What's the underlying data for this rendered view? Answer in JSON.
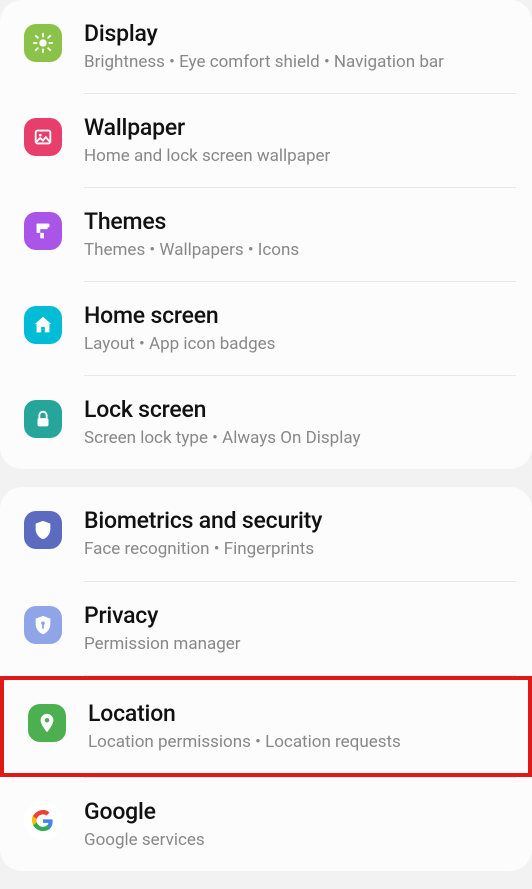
{
  "sections": [
    {
      "items": [
        {
          "id": "display",
          "title": "Display",
          "subtitle": "Brightness  •  Eye comfort shield  •  Navigation bar",
          "iconColor": "#8bc34a",
          "icon": "brightness"
        },
        {
          "id": "wallpaper",
          "title": "Wallpaper",
          "subtitle": "Home and lock screen wallpaper",
          "iconColor": "#e83e6b",
          "icon": "image"
        },
        {
          "id": "themes",
          "title": "Themes",
          "subtitle": "Themes  •  Wallpapers  •  Icons",
          "iconColor": "#a855e8",
          "icon": "paint"
        },
        {
          "id": "home-screen",
          "title": "Home screen",
          "subtitle": "Layout  •  App icon badges",
          "iconColor": "#00bcd4",
          "icon": "home"
        },
        {
          "id": "lock-screen",
          "title": "Lock screen",
          "subtitle": "Screen lock type  •  Always On Display",
          "iconColor": "#26a69a",
          "icon": "lock"
        }
      ]
    },
    {
      "items": [
        {
          "id": "biometrics",
          "title": "Biometrics and security",
          "subtitle": "Face recognition  •  Fingerprints",
          "iconColor": "#5c6bc0",
          "icon": "shield"
        },
        {
          "id": "privacy",
          "title": "Privacy",
          "subtitle": "Permission manager",
          "iconColor": "#90a4e8",
          "icon": "shield-key"
        },
        {
          "id": "location",
          "title": "Location",
          "subtitle": "Location permissions  •  Location requests",
          "iconColor": "#4caf50",
          "icon": "pin",
          "highlight": true
        },
        {
          "id": "google",
          "title": "Google",
          "subtitle": "Google services",
          "iconColor": "#ffffff",
          "icon": "google"
        }
      ]
    }
  ]
}
